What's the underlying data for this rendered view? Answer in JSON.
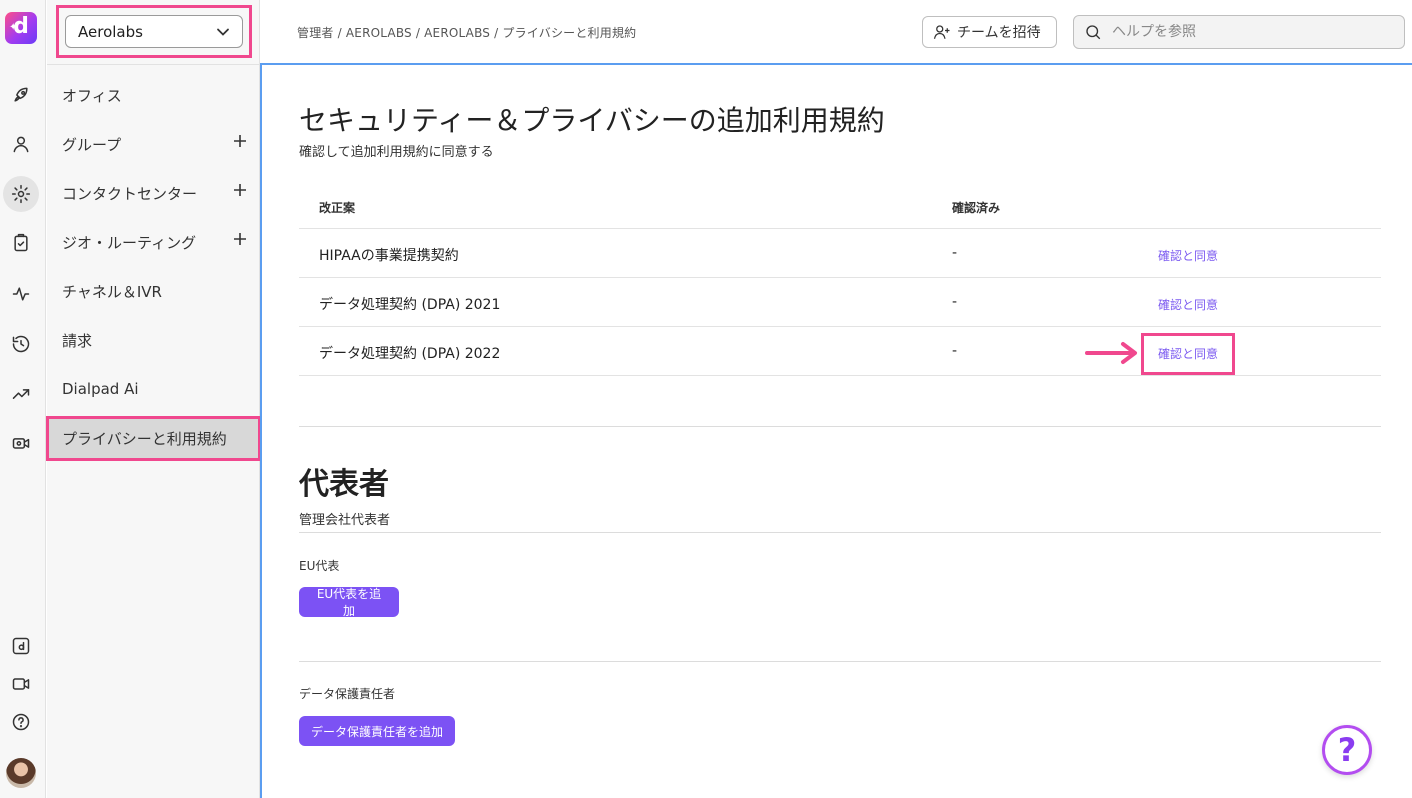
{
  "app": {
    "logo_letter": "d"
  },
  "org_select": {
    "value": "Aerolabs"
  },
  "sidebar": {
    "items": [
      {
        "label": "オフィス",
        "expandable": false
      },
      {
        "label": "グループ",
        "expandable": true
      },
      {
        "label": "コンタクトセンター",
        "expandable": true
      },
      {
        "label": "ジオ・ルーティング",
        "expandable": true
      },
      {
        "label": "チャネル＆IVR",
        "expandable": false
      },
      {
        "label": "請求",
        "expandable": false
      },
      {
        "label": "Dialpad Ai",
        "expandable": false
      },
      {
        "label": "プライバシーと利用規約",
        "expandable": false,
        "active": true
      }
    ]
  },
  "header": {
    "breadcrumb": "管理者 / AEROLABS / AEROLABS / プライバシーと利用規約",
    "invite_label": "チームを招待",
    "search_placeholder": "ヘルプを参照"
  },
  "main": {
    "title": "セキュリティー＆プライバシーの追加利用規約",
    "subtitle": "確認して追加利用規約に同意する",
    "table": {
      "headers": [
        "改正案",
        "確認済み"
      ],
      "rows": [
        {
          "name": "HIPAAの事業提携契約",
          "confirmed": "-",
          "action": "確認と同意"
        },
        {
          "name": "データ処理契約 (DPA) 2021",
          "confirmed": "-",
          "action": "確認と同意"
        },
        {
          "name": "データ処理契約 (DPA) 2022",
          "confirmed": "-",
          "action": "確認と同意"
        }
      ]
    },
    "representative": {
      "title": "代表者",
      "subtitle": "管理会社代表者",
      "eu_label": "EU代表",
      "eu_button": "EU代表を追加",
      "dpo_label": "データ保護責任者",
      "dpo_button": "データ保護責任者を追加"
    },
    "help_fab": "?"
  },
  "colors": {
    "accent": "#7c52f4",
    "highlight": "#f0488e",
    "focus_border": "#5b9df0"
  }
}
